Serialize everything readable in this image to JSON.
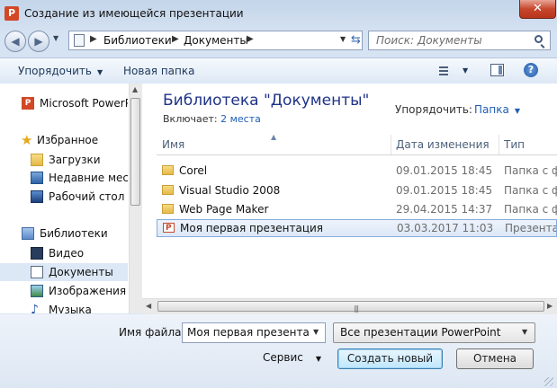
{
  "window": {
    "title": "Создание из имеющейся презентации",
    "app_icon": "P",
    "close": "✕"
  },
  "address": {
    "crumbs": [
      "Библиотеки",
      "Документы"
    ],
    "search_placeholder": "Поиск: Документы"
  },
  "toolbar": {
    "organize": "Упорядочить",
    "new_folder": "Новая папка",
    "help": "?"
  },
  "nav": {
    "items": [
      {
        "label": "Microsoft PowerPoint",
        "icon": "powerpoint-icon"
      },
      {
        "label": "Избранное",
        "icon": "star-icon"
      },
      {
        "label": "Загрузки",
        "icon": "downloads-folder-icon"
      },
      {
        "label": "Недавние места",
        "icon": "recent-places-icon"
      },
      {
        "label": "Рабочий стол",
        "icon": "desktop-icon"
      },
      {
        "label": "Библиотеки",
        "icon": "libraries-icon"
      },
      {
        "label": "Видео",
        "icon": "video-icon"
      },
      {
        "label": "Документы",
        "icon": "documents-icon",
        "selected": true
      },
      {
        "label": "Изображения",
        "icon": "pictures-icon"
      },
      {
        "label": "Музыка",
        "icon": "music-icon"
      }
    ]
  },
  "library": {
    "title": "Библиотека \"Документы\"",
    "includes_label": "Включает:",
    "includes_link": "2 места",
    "arrange_label": "Упорядочить:",
    "arrange_value": "Папка"
  },
  "columns": {
    "name": "Имя",
    "date": "Дата изменения",
    "type": "Тип"
  },
  "files": [
    {
      "name": "Corel",
      "date": "09.01.2015 18:45",
      "type": "Папка с ф",
      "kind": "folder"
    },
    {
      "name": "Visual Studio 2008",
      "date": "09.01.2015 18:45",
      "type": "Папка с ф",
      "kind": "folder"
    },
    {
      "name": "Web Page Maker",
      "date": "29.04.2015 14:37",
      "type": "Папка с ф",
      "kind": "folder"
    },
    {
      "name": "Моя первая презентация",
      "date": "03.03.2017 11:03",
      "type": "Презента",
      "kind": "presentation",
      "selected": true
    }
  ],
  "bottom": {
    "filename_label": "Имя файла:",
    "filename_value": "Моя первая презентация",
    "filetype_value": "Все презентации PowerPoint",
    "tools_label": "Сервис",
    "create_button": "Создать новый",
    "cancel_button": "Отмена"
  }
}
